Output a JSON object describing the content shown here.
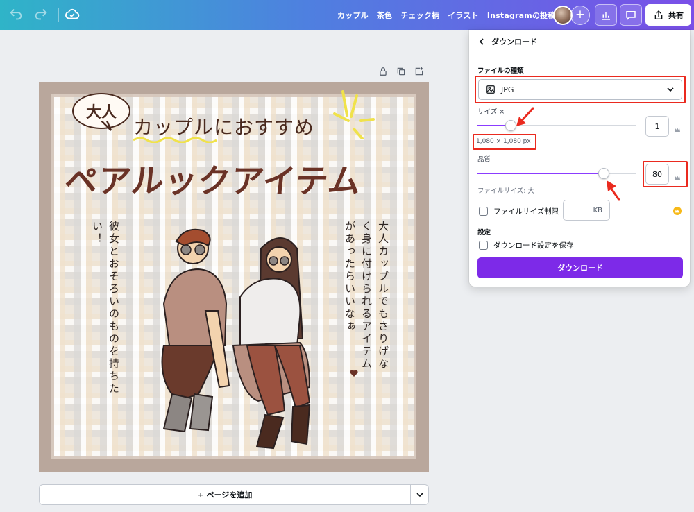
{
  "topbar": {
    "links": [
      "カップル",
      "茶色",
      "チェック柄",
      "イラスト",
      "Instagramの投稿"
    ],
    "share_label": "共有",
    "icons": [
      "undo-icon",
      "redo-icon",
      "cloud-saved-icon",
      "plus-icon",
      "bar-chart-icon",
      "comment-icon",
      "share-upload-icon"
    ]
  },
  "design": {
    "bubble_text": "大人",
    "subtitle": "カップルにおすすめ",
    "title": "ペアルックアイテム",
    "left_vertical_text": "彼女とおそろいのものを持ちたい！",
    "right_vertical_text": "大人カップルでもさりげなく身に付けられるアイテムがあったらいいなぁ",
    "colors": {
      "frame": "#b9a79c",
      "title": "#6a3226",
      "ink": "#4a2a1f"
    }
  },
  "canvas": {
    "add_page_label": "+ ページを追加"
  },
  "download_panel": {
    "back_label": "ダウンロード",
    "file_type_label": "ファイルの種類",
    "file_type_value": "JPG",
    "size_label": "サイズ ×",
    "size_value": "1",
    "size_slider": 0.21,
    "dimensions": "1,080 × 1,080 px",
    "quality_label": "品質",
    "quality_value": "80",
    "quality_slider": 0.8,
    "file_size_hint": "ファイルサイズ: 大",
    "limit_label": "ファイルサイズ制限",
    "kb_unit": "KB",
    "settings_label": "設定",
    "save_settings_label": "ダウンロード設定を保存",
    "download_button": "ダウンロード",
    "accent": "#7d2ae8",
    "highlight": "#ea2a1f"
  }
}
